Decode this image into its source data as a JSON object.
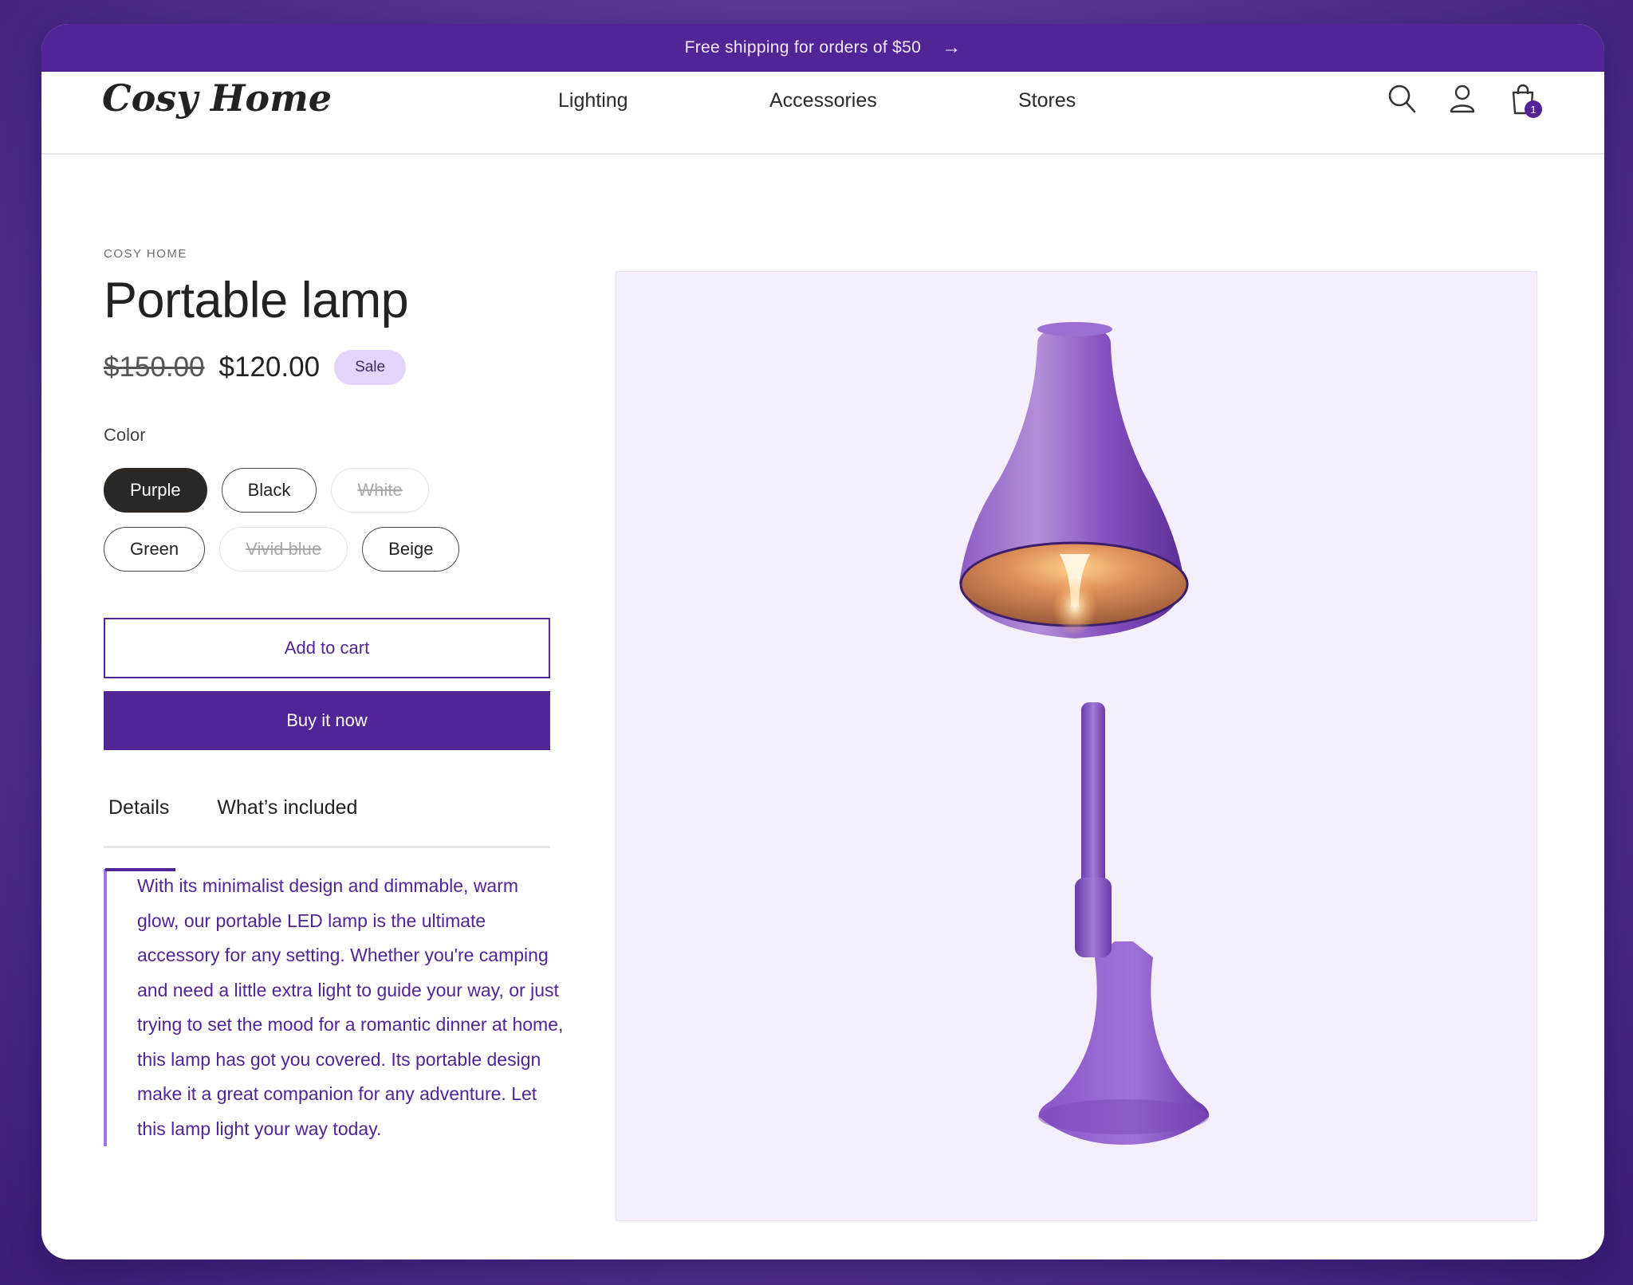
{
  "announcement": {
    "text": "Free shipping for orders of $50",
    "arrow": "→"
  },
  "header": {
    "logo": "Cosy Home",
    "nav": [
      "Lighting",
      "Accessories",
      "Stores"
    ],
    "cart_count": "1",
    "icons": [
      "search-icon",
      "account-icon",
      "cart-icon"
    ]
  },
  "product": {
    "vendor": "COSY HOME",
    "title": "Portable lamp",
    "price_old": "$150.00",
    "price_new": "$120.00",
    "sale_label": "Sale",
    "color_label": "Color",
    "colors": [
      {
        "label": "Purple",
        "state": "selected"
      },
      {
        "label": "Black",
        "state": "available"
      },
      {
        "label": "White",
        "state": "unavailable"
      },
      {
        "label": "Green",
        "state": "available"
      },
      {
        "label": "Vivid blue",
        "state": "unavailable"
      },
      {
        "label": "Beige",
        "state": "available"
      }
    ],
    "add_to_cart": "Add to cart",
    "buy_now": "Buy it now",
    "tabs": [
      "Details",
      "What’s included"
    ],
    "details_text": "With its minimalist design and dimmable, warm glow, our portable LED lamp is the ultimate accessory for any setting. Whether you're camping and need a little extra light to guide your way, or just trying to set the mood for a romantic dinner at home, this lamp has got you covered. Its portable design make it a great companion for any adventure. Let this lamp light your way today."
  },
  "colors": {
    "brand": "#512596",
    "sale_badge": "#e3d4fb",
    "image_bg": "#f5effd"
  }
}
